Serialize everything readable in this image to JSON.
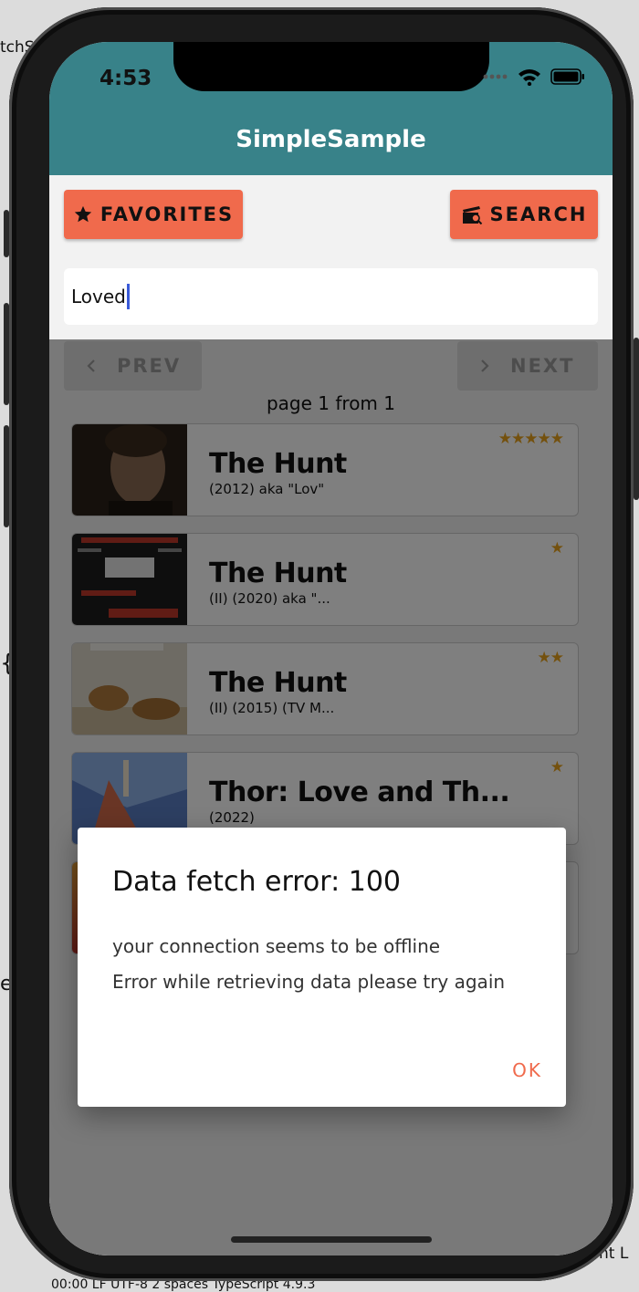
{
  "background": {
    "frag_top_left": "tchS",
    "frag_mid_left": "{",
    "frag_lower_left": "e",
    "frag_bottom_right": "nt L",
    "frag_bottom": "00:00   LF   UTF-8   2 spaces   TypeScript 4.9.3"
  },
  "status_bar": {
    "time": "4:53"
  },
  "app": {
    "title": "SimpleSample",
    "favorites_label": "FAVORITES",
    "search_label": "SEARCH",
    "search_value": "Loved",
    "prev_label": "PREV",
    "next_label": "NEXT",
    "page_info": "page 1 from 1"
  },
  "movies": [
    {
      "title": "The Hunt",
      "subtitle": "(2012) aka \"Lov\"",
      "stars": "★★★★★"
    },
    {
      "title": "The Hunt",
      "subtitle": "(II) (2020) aka \"...",
      "stars": "★"
    },
    {
      "title": "The Hunt",
      "subtitle": "(II) (2015) (TV M...",
      "stars": "★★"
    },
    {
      "title": "Thor: Love and Th...",
      "subtitle": "(2022)",
      "stars": "★"
    }
  ],
  "dialog": {
    "title": "Data fetch error: 100",
    "line1": "your connection seems to be offline",
    "line2": "Error while retrieving data please try again",
    "ok_label": "OK"
  },
  "colors": {
    "app_bar": "#388289",
    "accent": "#f06a4c",
    "star": "#e8a21c"
  }
}
